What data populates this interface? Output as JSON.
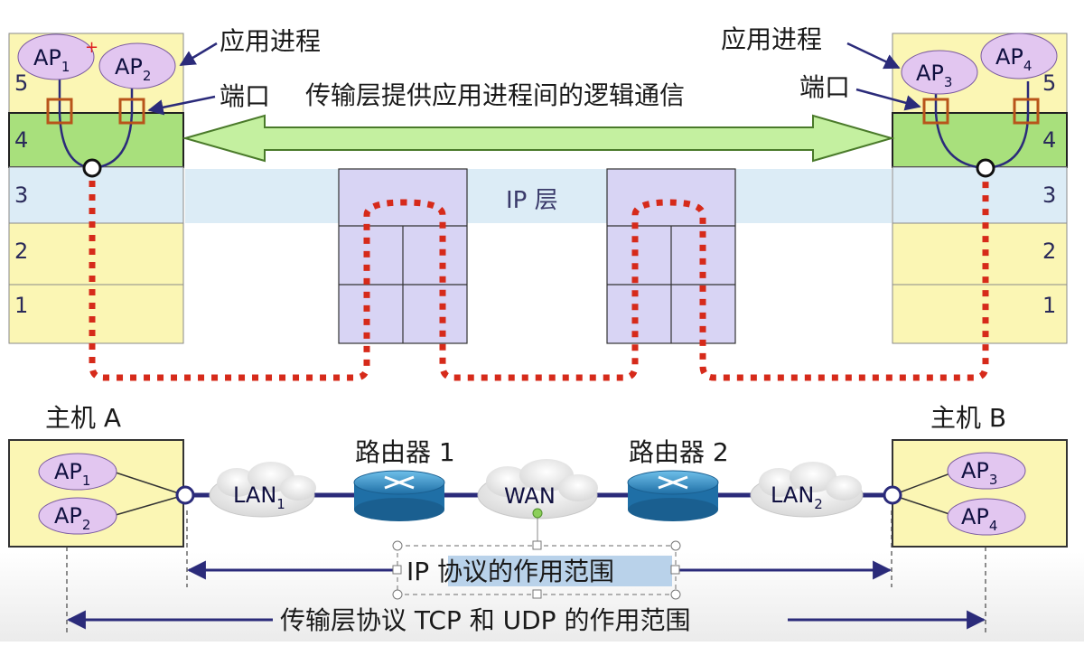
{
  "labels": {
    "app_process_left": "应用进程",
    "app_process_right": "应用进程",
    "port_left": "端口",
    "port_right": "端口",
    "transport_logic": "传输层提供应用进程间的逻辑通信",
    "ip_layer": "IP 层",
    "host_a": "主机 A",
    "host_b": "主机 B",
    "router_1": "路由器 1",
    "router_2": "路由器 2",
    "lan": "LAN",
    "wan": "WAN",
    "ip_scope_prefix": "IP ",
    "ip_scope_highlight": "协议的作用范围",
    "tcp_udp_scope": "传输层协议 TCP 和 UDP 的作用范围"
  },
  "layers": [
    "5",
    "4",
    "3",
    "2",
    "1"
  ],
  "processes": {
    "ap": "AP",
    "sub1": "1",
    "sub2": "2",
    "sub3": "3",
    "sub4": "4",
    "lan_sub1": "1",
    "lan_sub2": "2",
    "cursor_mark": "+"
  },
  "colors": {
    "host_fill": "#fbf6b4",
    "layer4_fill": "#a8e07c",
    "ip_band": "#dcecf6",
    "router_box": "#d8d4f4",
    "ap_fill": "#e2c6f0",
    "port_box": "#b8541a",
    "dotted_path": "#d62a1a",
    "arrow_fill": "#c4f0a0",
    "line_dark": "#2b2b7a",
    "router_icon": "#3a8ac0",
    "selection_fill": "#b9d2ea"
  }
}
